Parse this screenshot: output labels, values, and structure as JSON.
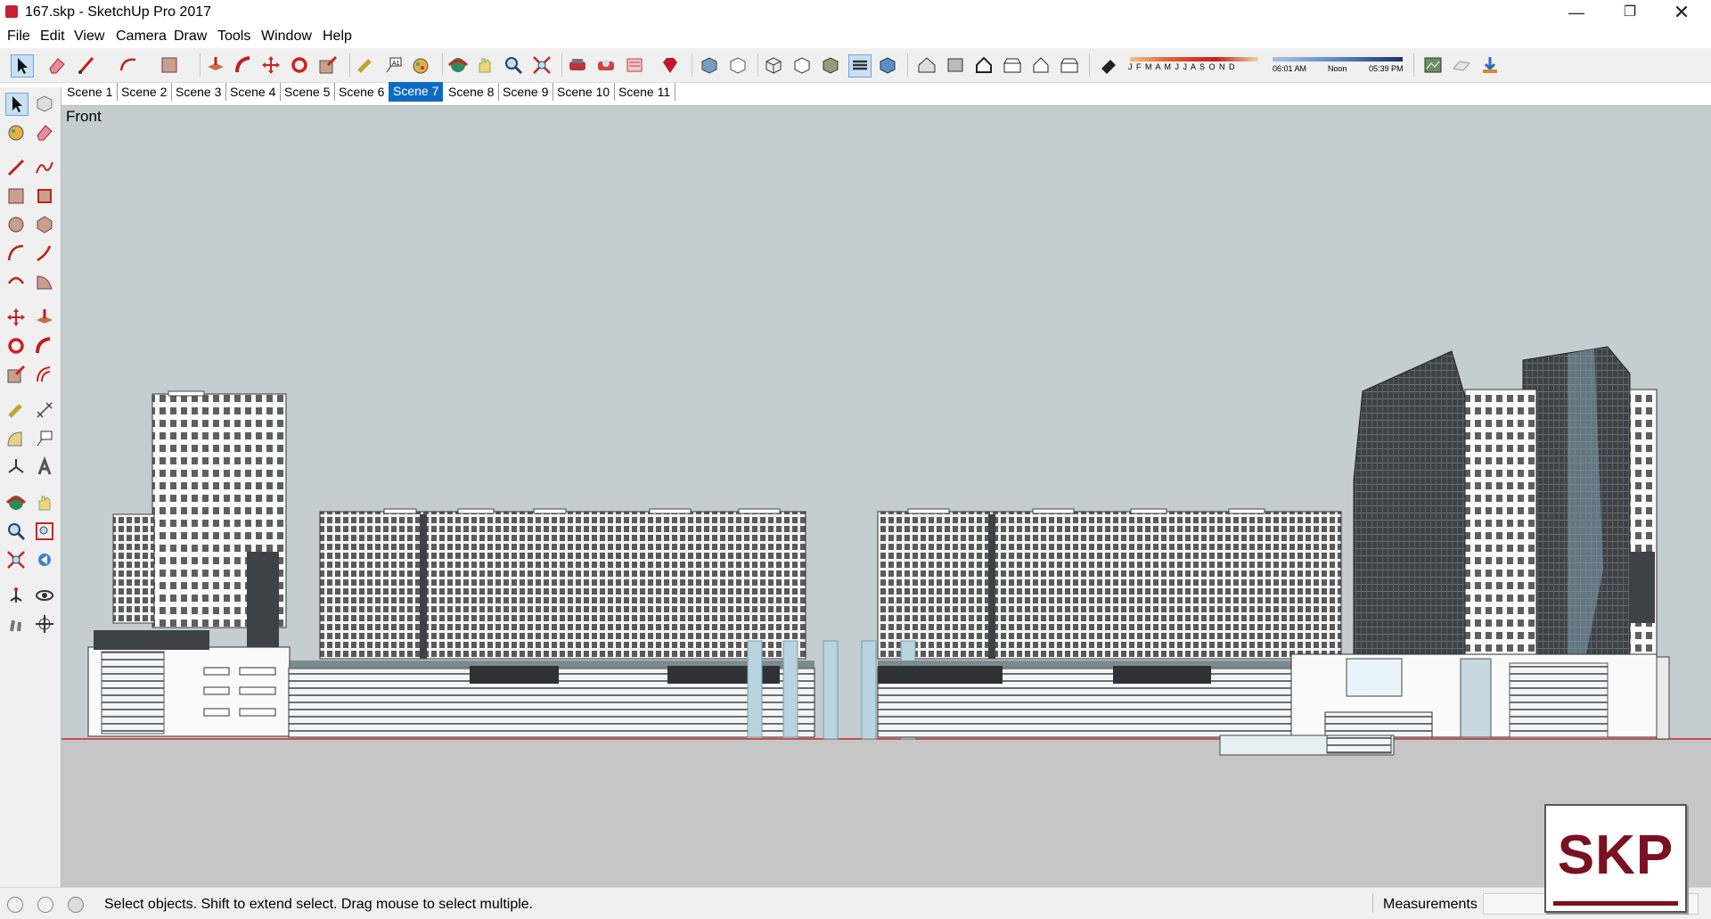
{
  "window": {
    "title": "167.skp - SketchUp Pro 2017",
    "controls": [
      "minimize",
      "maximize",
      "close"
    ]
  },
  "menu": [
    "File",
    "Edit",
    "View",
    "Camera",
    "Draw",
    "Tools",
    "Window",
    "Help"
  ],
  "shadows": {
    "months": "J F M A M J J A S O N D",
    "time_start": "06:01 AM",
    "time_mid": "Noon",
    "time_end": "05:39 PM"
  },
  "scenes": [
    "Scene 1",
    "Scene 2",
    "Scene 3",
    "Scene 4",
    "Scene 5",
    "Scene 6",
    "Scene 7",
    "Scene 8",
    "Scene 9",
    "Scene 10",
    "Scene 11"
  ],
  "active_scene": "Scene 7",
  "viewport": {
    "view_name": "Front",
    "sky_color": "#c4cdd0",
    "ground_color": "#c6c6c6"
  },
  "status": {
    "hint": "Select objects. Shift to extend select. Drag mouse to select multiple.",
    "measurements_label": "Measurements",
    "measurements_value": ""
  },
  "watermark": {
    "text": "SKP",
    "color": "#7a1022"
  },
  "colors": {
    "accent": "#0f6bc2",
    "app_icon": "#c8202c"
  }
}
